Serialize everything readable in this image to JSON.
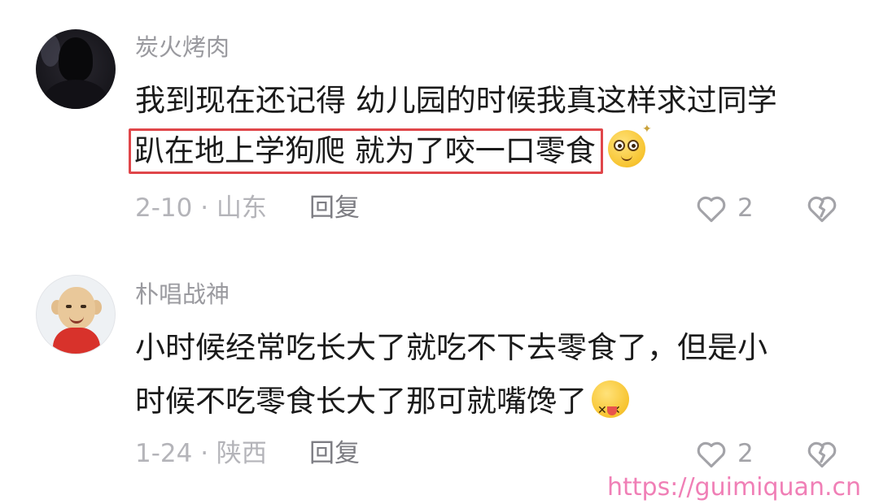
{
  "comments": [
    {
      "username": "炭火烤肉",
      "lines": [
        "我到现在还记得 幼儿园的时候我真这样求过同学",
        "趴在地上学狗爬 就为了咬一口零食"
      ],
      "emoji_icon": "dizzy-eyes-emoji",
      "date_location": "2-10 · 山东",
      "reply_label": "回复",
      "like_count": "2"
    },
    {
      "username": "朴唱战神",
      "lines": [
        "小时候经常吃长大了就吃不下去零食了，但是小",
        "时候不吃零食长大了那可就嘴馋了"
      ],
      "emoji_icon": "silly-tongue-emoji",
      "date_location": "1-24 · 陕西",
      "reply_label": "回复",
      "like_count": "2"
    }
  ],
  "icons": {
    "like": "heart-outline-icon",
    "dislike": "broken-heart-icon"
  },
  "colors": {
    "highlight_border": "#e0464a",
    "watermark": "#f07fb6"
  },
  "watermark": "https://guimiquan.cn"
}
